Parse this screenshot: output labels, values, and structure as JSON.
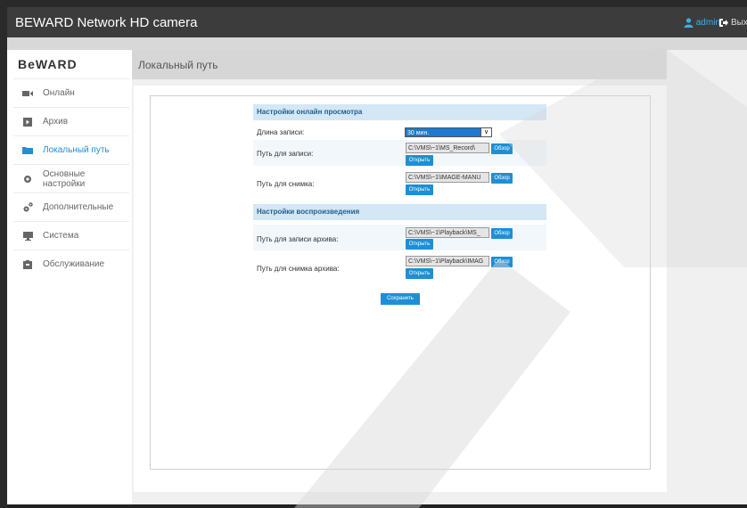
{
  "header": {
    "title": "BEWARD Network HD camera",
    "user": "admin",
    "logout": "Выход"
  },
  "logo": "BeWARD",
  "sidebar": {
    "items": [
      {
        "label": "Онлайн",
        "icon": "camera-icon"
      },
      {
        "label": "Архив",
        "icon": "play-icon"
      },
      {
        "label": "Локальный путь",
        "icon": "folder-icon",
        "active": true
      },
      {
        "label": "Основные настройки",
        "icon": "gear-icon"
      },
      {
        "label": "Дополнительные",
        "icon": "gears-icon"
      },
      {
        "label": "Система",
        "icon": "monitor-icon"
      },
      {
        "label": "Обслуживание",
        "icon": "box-icon"
      }
    ]
  },
  "page": {
    "title": "Локальный путь"
  },
  "online": {
    "heading": "Настройки онлайн просмотра",
    "record_length_label": "Длина записи:",
    "record_length_value": "30 мин.",
    "record_path_label": "Путь для записи:",
    "record_path_value": "C:\\VMS\\~1\\MS_Record\\",
    "snapshot_path_label": "Путь для снимка:",
    "snapshot_path_value": "C:\\VMS\\~1\\IMAGE-MANU"
  },
  "playback": {
    "heading": "Настройки воспроизведения",
    "archive_record_label": "Путь для записи архива:",
    "archive_record_value": "C:\\VMS\\~1\\Playback\\MS_",
    "archive_snapshot_label": "Путь для снимка архива:",
    "archive_snapshot_value": "C:\\VMS\\~1\\Playback\\IMAG"
  },
  "buttons": {
    "browse": "Обзор",
    "open": "Открыть",
    "save": "Сохранить"
  },
  "colors": {
    "accent": "#1e8fd5",
    "active_nav": "#1f8fd6",
    "section_head": "#d4e7f5"
  }
}
